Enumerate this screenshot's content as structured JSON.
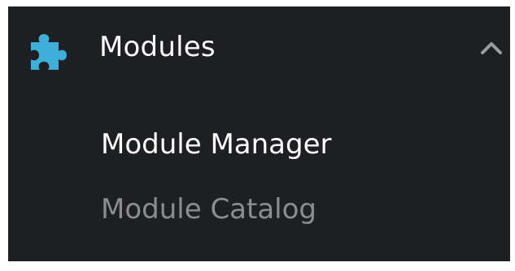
{
  "colors": {
    "panel_background": "#1e1f22",
    "icon_accent": "#3dafd8",
    "active_text": "#ffffff",
    "inactive_text": "#8c8d90",
    "chevron": "#9a9ca0"
  },
  "menu": {
    "section": {
      "icon": "puzzle-piece-icon",
      "label": "Modules",
      "expanded": true,
      "toggle_icon": "chevron-up-icon"
    },
    "items": [
      {
        "label": "Module Manager",
        "active": true
      },
      {
        "label": "Module Catalog",
        "active": false
      }
    ]
  }
}
